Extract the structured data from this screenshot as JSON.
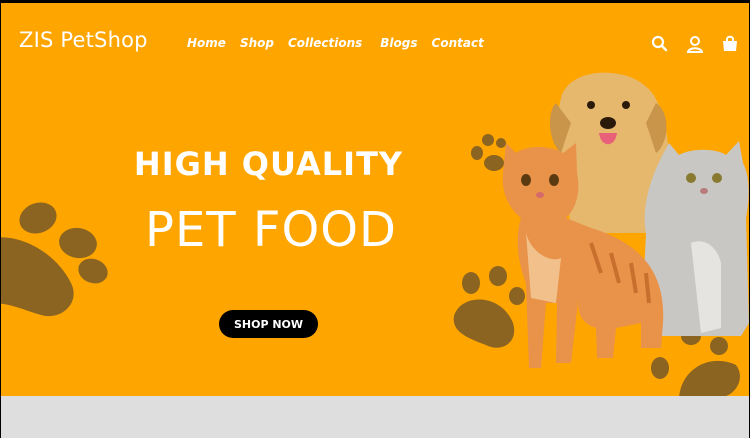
{
  "brand": {
    "name": "ZIS PetShop"
  },
  "nav": {
    "items": [
      {
        "label": "Home"
      },
      {
        "label": "Shop"
      },
      {
        "label": "Collections"
      },
      {
        "label": "Blogs"
      },
      {
        "label": "Contact"
      }
    ]
  },
  "header_icons": [
    "search-icon",
    "user-icon",
    "shopping-bag-icon"
  ],
  "hero": {
    "headline_top": "HIGH QUALITY",
    "headline_main": "PET FOOD",
    "cta_label": "SHOP NOW"
  },
  "colors": {
    "background": "#ffa500",
    "paw": "#8a6420",
    "cta_background": "#000000",
    "text": "#ffffff",
    "footer_strip": "#dedede"
  }
}
